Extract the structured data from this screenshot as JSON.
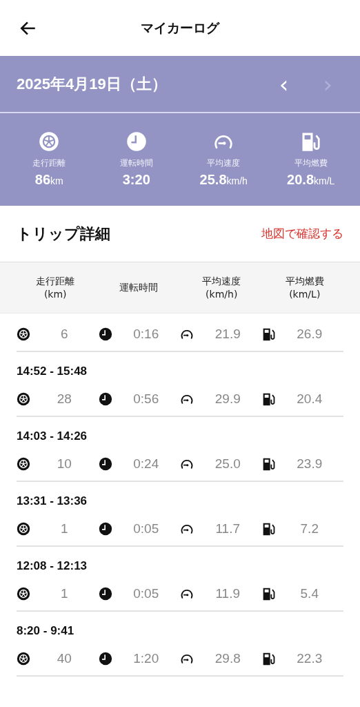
{
  "app_bar": {
    "title": "マイカーログ"
  },
  "date_bar": {
    "date": "2025年4月19日（土）",
    "nav": [
      {
        "glyph": "‹",
        "disabled": false
      },
      {
        "glyph": "›",
        "disabled": true
      }
    ]
  },
  "summary": [
    {
      "kind": "distance",
      "label": "走行距離",
      "value": "86",
      "unit": "km"
    },
    {
      "kind": "time",
      "label": "運転時間",
      "value": "3:20"
    },
    {
      "kind": "speed",
      "label": "平均速度",
      "value": "25.8",
      "unit": "km/h"
    },
    {
      "kind": "fuel",
      "label": "平均燃費",
      "value": "20.8",
      "unit": "km/L"
    }
  ],
  "section": {
    "title": "トリップ詳細",
    "link": "地図で確認する"
  },
  "table": {
    "columns": [
      {
        "kind": "distance",
        "label": "走行距離",
        "unit": "(km)"
      },
      {
        "kind": "time",
        "label": "運転時間"
      },
      {
        "kind": "speed",
        "label": "平均速度",
        "unit": "(km/h)"
      },
      {
        "kind": "fuel",
        "label": "平均燃費",
        "unit": "(km/L)"
      }
    ],
    "trips": [
      {
        "values": [
          "6",
          "0:16",
          "21.9",
          "26.9"
        ]
      },
      {
        "time": "14:52 - 15:48",
        "values": [
          "28",
          "0:56",
          "29.9",
          "20.4"
        ]
      },
      {
        "time": "14:03 - 14:26",
        "values": [
          "10",
          "0:24",
          "25.0",
          "23.9"
        ]
      },
      {
        "time": "13:31 - 13:36",
        "values": [
          "1",
          "0:05",
          "11.7",
          "7.2"
        ]
      },
      {
        "time": "12:08 - 12:13",
        "values": [
          "1",
          "0:05",
          "11.9",
          "5.4"
        ]
      },
      {
        "time": "8:20 - 9:41",
        "values": [
          "40",
          "1:20",
          "29.8",
          "22.3"
        ]
      }
    ]
  }
}
